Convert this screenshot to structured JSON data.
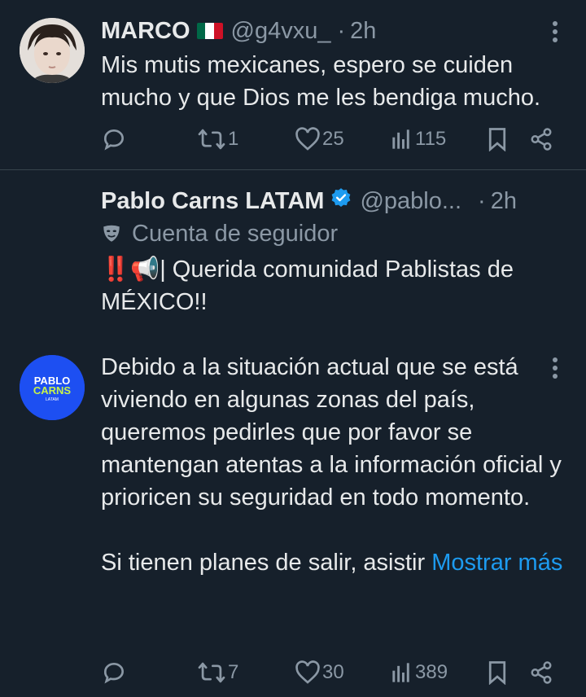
{
  "tweets": [
    {
      "name": "MARCO",
      "handle": "@g4vxu_",
      "dot": "·",
      "time": "2h",
      "text": "Mis mutis mexicanes, espero se cuiden mucho y que Dios me les bendiga mucho.",
      "replies": "",
      "retweets": "1",
      "likes": "25",
      "views": "115"
    },
    {
      "name": "Pablo Carns LATAM",
      "handle": "@pablo...",
      "dot": "·",
      "time": "2h",
      "sub_label": "Cuenta de seguidor",
      "avatar_text_1": "PABLO",
      "avatar_text_2": "CARNS",
      "avatar_text_3": "LATAM",
      "text_line1": "‼️📢| Querida comunidad Pablistas de MÉXICO!!",
      "text_para2": "Debido a la situación actual que se está viviendo en algunas zonas del país, queremos pedirles que por favor se mantengan atentas a la información oficial y prioricen su seguridad en todo momento.",
      "text_para3": "Si tienen planes de salir, asistir ",
      "show_more": "Mostrar más",
      "replies": "",
      "retweets": "7",
      "likes": "30",
      "views": "389"
    }
  ],
  "colors": {
    "background": "#16202b",
    "text": "#e7e9ea",
    "muted": "#8b98a5",
    "link": "#1d9bf0",
    "verified": "#1d9bf0",
    "avatar2_bg": "#1d4ff2"
  }
}
